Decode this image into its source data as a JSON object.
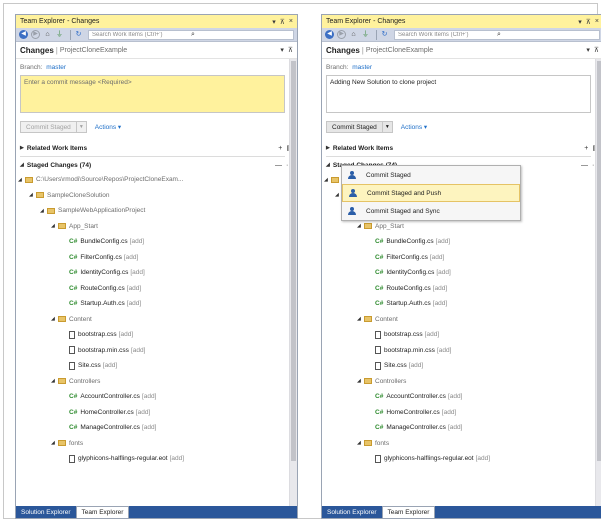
{
  "panels": [
    {
      "window_title": "Team Explorer - Changes",
      "window_controls": [
        "▾",
        "⊼",
        "×"
      ],
      "search_placeholder": "Search Work Items (Ctrl+')",
      "page_title": "Changes",
      "page_subtitle": "ProjectCloneExample",
      "branch_label": "Branch:",
      "branch_value": "master",
      "commit_message": "Enter a commit message <Required>",
      "commit_button": "Commit Staged",
      "actions_label": "Actions ▾",
      "related_items": "Related Work Items",
      "staged_changes": "Staged Changes (74)",
      "tabs": [
        "Solution Explorer",
        "Team Explorer"
      ]
    },
    {
      "window_title": "Team Explorer - Changes",
      "window_controls": [
        "▾",
        "⊼",
        "×"
      ],
      "search_placeholder": "Search Work Items (Ctrl+')",
      "page_title": "Changes",
      "page_subtitle": "ProjectCloneExample",
      "branch_label": "Branch:",
      "branch_value": "master",
      "commit_message": "Adding New Solution to clone project",
      "commit_button": "Commit Staged",
      "actions_label": "Actions ▾",
      "related_items": "Related Work Items",
      "staged_changes": "Staged Changes (74)",
      "tabs": [
        "Solution Explorer",
        "Team Explorer"
      ]
    }
  ],
  "tree_left": [
    {
      "type": "folder",
      "depth": 1,
      "name": "C:\\Users\\rmodi\\Source\\Repos\\ProjectCloneExam..."
    },
    {
      "type": "folder",
      "depth": 2,
      "name": "SampleCloneSolution"
    },
    {
      "type": "folder",
      "depth": 3,
      "name": "SampleWebApplicationProject"
    },
    {
      "type": "folder",
      "depth": 4,
      "name": "App_Start"
    },
    {
      "type": "cs",
      "depth": 5,
      "name": "BundleConfig.cs",
      "tag": "[add]"
    },
    {
      "type": "cs",
      "depth": 5,
      "name": "FilterConfig.cs",
      "tag": "[add]"
    },
    {
      "type": "cs",
      "depth": 5,
      "name": "IdentityConfig.cs",
      "tag": "[add]"
    },
    {
      "type": "cs",
      "depth": 5,
      "name": "RouteConfig.cs",
      "tag": "[add]"
    },
    {
      "type": "cs",
      "depth": 5,
      "name": "Startup.Auth.cs",
      "tag": "[add]"
    },
    {
      "type": "folder",
      "depth": 4,
      "name": "Content"
    },
    {
      "type": "css",
      "depth": 5,
      "name": "bootstrap.css",
      "tag": "[add]"
    },
    {
      "type": "css",
      "depth": 5,
      "name": "bootstrap.min.css",
      "tag": "[add]"
    },
    {
      "type": "css",
      "depth": 5,
      "name": "Site.css",
      "tag": "[add]"
    },
    {
      "type": "folder",
      "depth": 4,
      "name": "Controllers"
    },
    {
      "type": "cs",
      "depth": 5,
      "name": "AccountController.cs",
      "tag": "[add]"
    },
    {
      "type": "cs",
      "depth": 5,
      "name": "HomeController.cs",
      "tag": "[add]"
    },
    {
      "type": "cs",
      "depth": 5,
      "name": "ManageController.cs",
      "tag": "[add]"
    },
    {
      "type": "folder",
      "depth": 4,
      "name": "fonts"
    },
    {
      "type": "font",
      "depth": 5,
      "name": "glyphicons-halflings-regular.eot",
      "tag": "[add]"
    }
  ],
  "tree_right": [
    {
      "type": "folder",
      "depth": 1,
      "name": "ectCloneExam..."
    },
    {
      "type": "folder",
      "depth": 2,
      "name": "SampleCloneSolution"
    },
    {
      "type": "folder",
      "depth": 3,
      "name": "SampleWebApplicationProject"
    },
    {
      "type": "folder",
      "depth": 4,
      "name": "App_Start"
    },
    {
      "type": "cs",
      "depth": 5,
      "name": "BundleConfig.cs",
      "tag": "[add]"
    },
    {
      "type": "cs",
      "depth": 5,
      "name": "FilterConfig.cs",
      "tag": "[add]"
    },
    {
      "type": "cs",
      "depth": 5,
      "name": "IdentityConfig.cs",
      "tag": "[add]"
    },
    {
      "type": "cs",
      "depth": 5,
      "name": "RouteConfig.cs",
      "tag": "[add]"
    },
    {
      "type": "cs",
      "depth": 5,
      "name": "Startup.Auth.cs",
      "tag": "[add]"
    },
    {
      "type": "folder",
      "depth": 4,
      "name": "Content"
    },
    {
      "type": "css",
      "depth": 5,
      "name": "bootstrap.css",
      "tag": "[add]"
    },
    {
      "type": "css",
      "depth": 5,
      "name": "bootstrap.min.css",
      "tag": "[add]"
    },
    {
      "type": "css",
      "depth": 5,
      "name": "Site.css",
      "tag": "[add]"
    },
    {
      "type": "folder",
      "depth": 4,
      "name": "Controllers"
    },
    {
      "type": "cs",
      "depth": 5,
      "name": "AccountController.cs",
      "tag": "[add]"
    },
    {
      "type": "cs",
      "depth": 5,
      "name": "HomeController.cs",
      "tag": "[add]"
    },
    {
      "type": "cs",
      "depth": 5,
      "name": "ManageController.cs",
      "tag": "[add]"
    },
    {
      "type": "folder",
      "depth": 4,
      "name": "fonts"
    },
    {
      "type": "font",
      "depth": 5,
      "name": "glyphicons-halflings-regular.eot",
      "tag": "[add]"
    }
  ],
  "dropdown": {
    "items": [
      "Commit Staged",
      "Commit Staged and Push",
      "Commit Staged and Sync"
    ],
    "highlighted": "Commit Staged and Push"
  },
  "colors": {
    "title_bar": "#fff29d",
    "message_empty": "#fff29d",
    "link": "#1e6fc8",
    "tab_strip": "#2b579a",
    "dropdown_highlight": "#fdf4bf"
  }
}
